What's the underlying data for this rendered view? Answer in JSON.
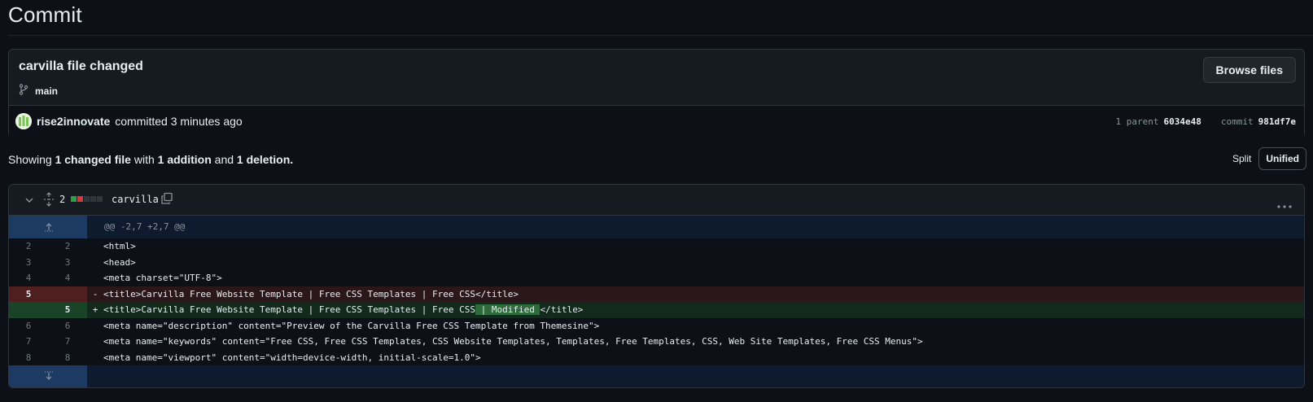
{
  "page": {
    "title": "Commit"
  },
  "commit": {
    "message": "carvilla file changed",
    "branch": "main",
    "browse_label": "Browse files",
    "author": "rise2innovate",
    "committed_text": "committed 3 minutes ago",
    "parent_label": "1 parent",
    "parent_sha": "6034e48",
    "commit_label": "commit",
    "commit_sha": "981df7e"
  },
  "summary": {
    "showing": "Showing",
    "changed": "1 changed file",
    "with": "with",
    "additions": "1 addition",
    "and": "and",
    "deletions": "1 deletion",
    "period": "."
  },
  "view_toggle": {
    "split": "Split",
    "unified": "Unified"
  },
  "file": {
    "changes": "2",
    "name": "carvilla",
    "hunk_header": "@@ -2,7 +2,7 @@",
    "lines": [
      {
        "type": "ctx",
        "old": "2",
        "new": "2",
        "marker": " ",
        "text": "<html>"
      },
      {
        "type": "ctx",
        "old": "3",
        "new": "3",
        "marker": " ",
        "text": "<head>"
      },
      {
        "type": "ctx",
        "old": "4",
        "new": "4",
        "marker": " ",
        "text": "<meta charset=\"UTF-8\">"
      },
      {
        "type": "del",
        "old": "5",
        "new": "",
        "marker": "-",
        "text": "<title>Carvilla Free Website Template | Free CSS Templates | Free CSS</title>"
      },
      {
        "type": "add",
        "old": "",
        "new": "5",
        "marker": "+",
        "text_pre": "<title>Carvilla Free Website Template | Free CSS Templates | Free CSS",
        "text_hl": " | Modified ",
        "text_post": "</title>"
      },
      {
        "type": "ctx",
        "old": "6",
        "new": "6",
        "marker": " ",
        "text": "<meta name=\"description\" content=\"Preview of the Carvilla Free CSS Template from Themesine\">"
      },
      {
        "type": "ctx",
        "old": "7",
        "new": "7",
        "marker": " ",
        "text": "<meta name=\"keywords\" content=\"Free CSS, Free CSS Templates, CSS Website Templates, Templates, Free Templates, CSS, Web Site Templates, Free CSS Menus\">"
      },
      {
        "type": "ctx",
        "old": "8",
        "new": "8",
        "marker": " ",
        "text": "<meta name=\"viewport\" content=\"width=device-width, initial-scale=1.0\">"
      }
    ]
  },
  "colors": {
    "background": "#0d1117",
    "deletion": "#2b1719",
    "addition": "#112a1c",
    "hunk": "#1d3a62",
    "accent": "#e6edf3"
  }
}
